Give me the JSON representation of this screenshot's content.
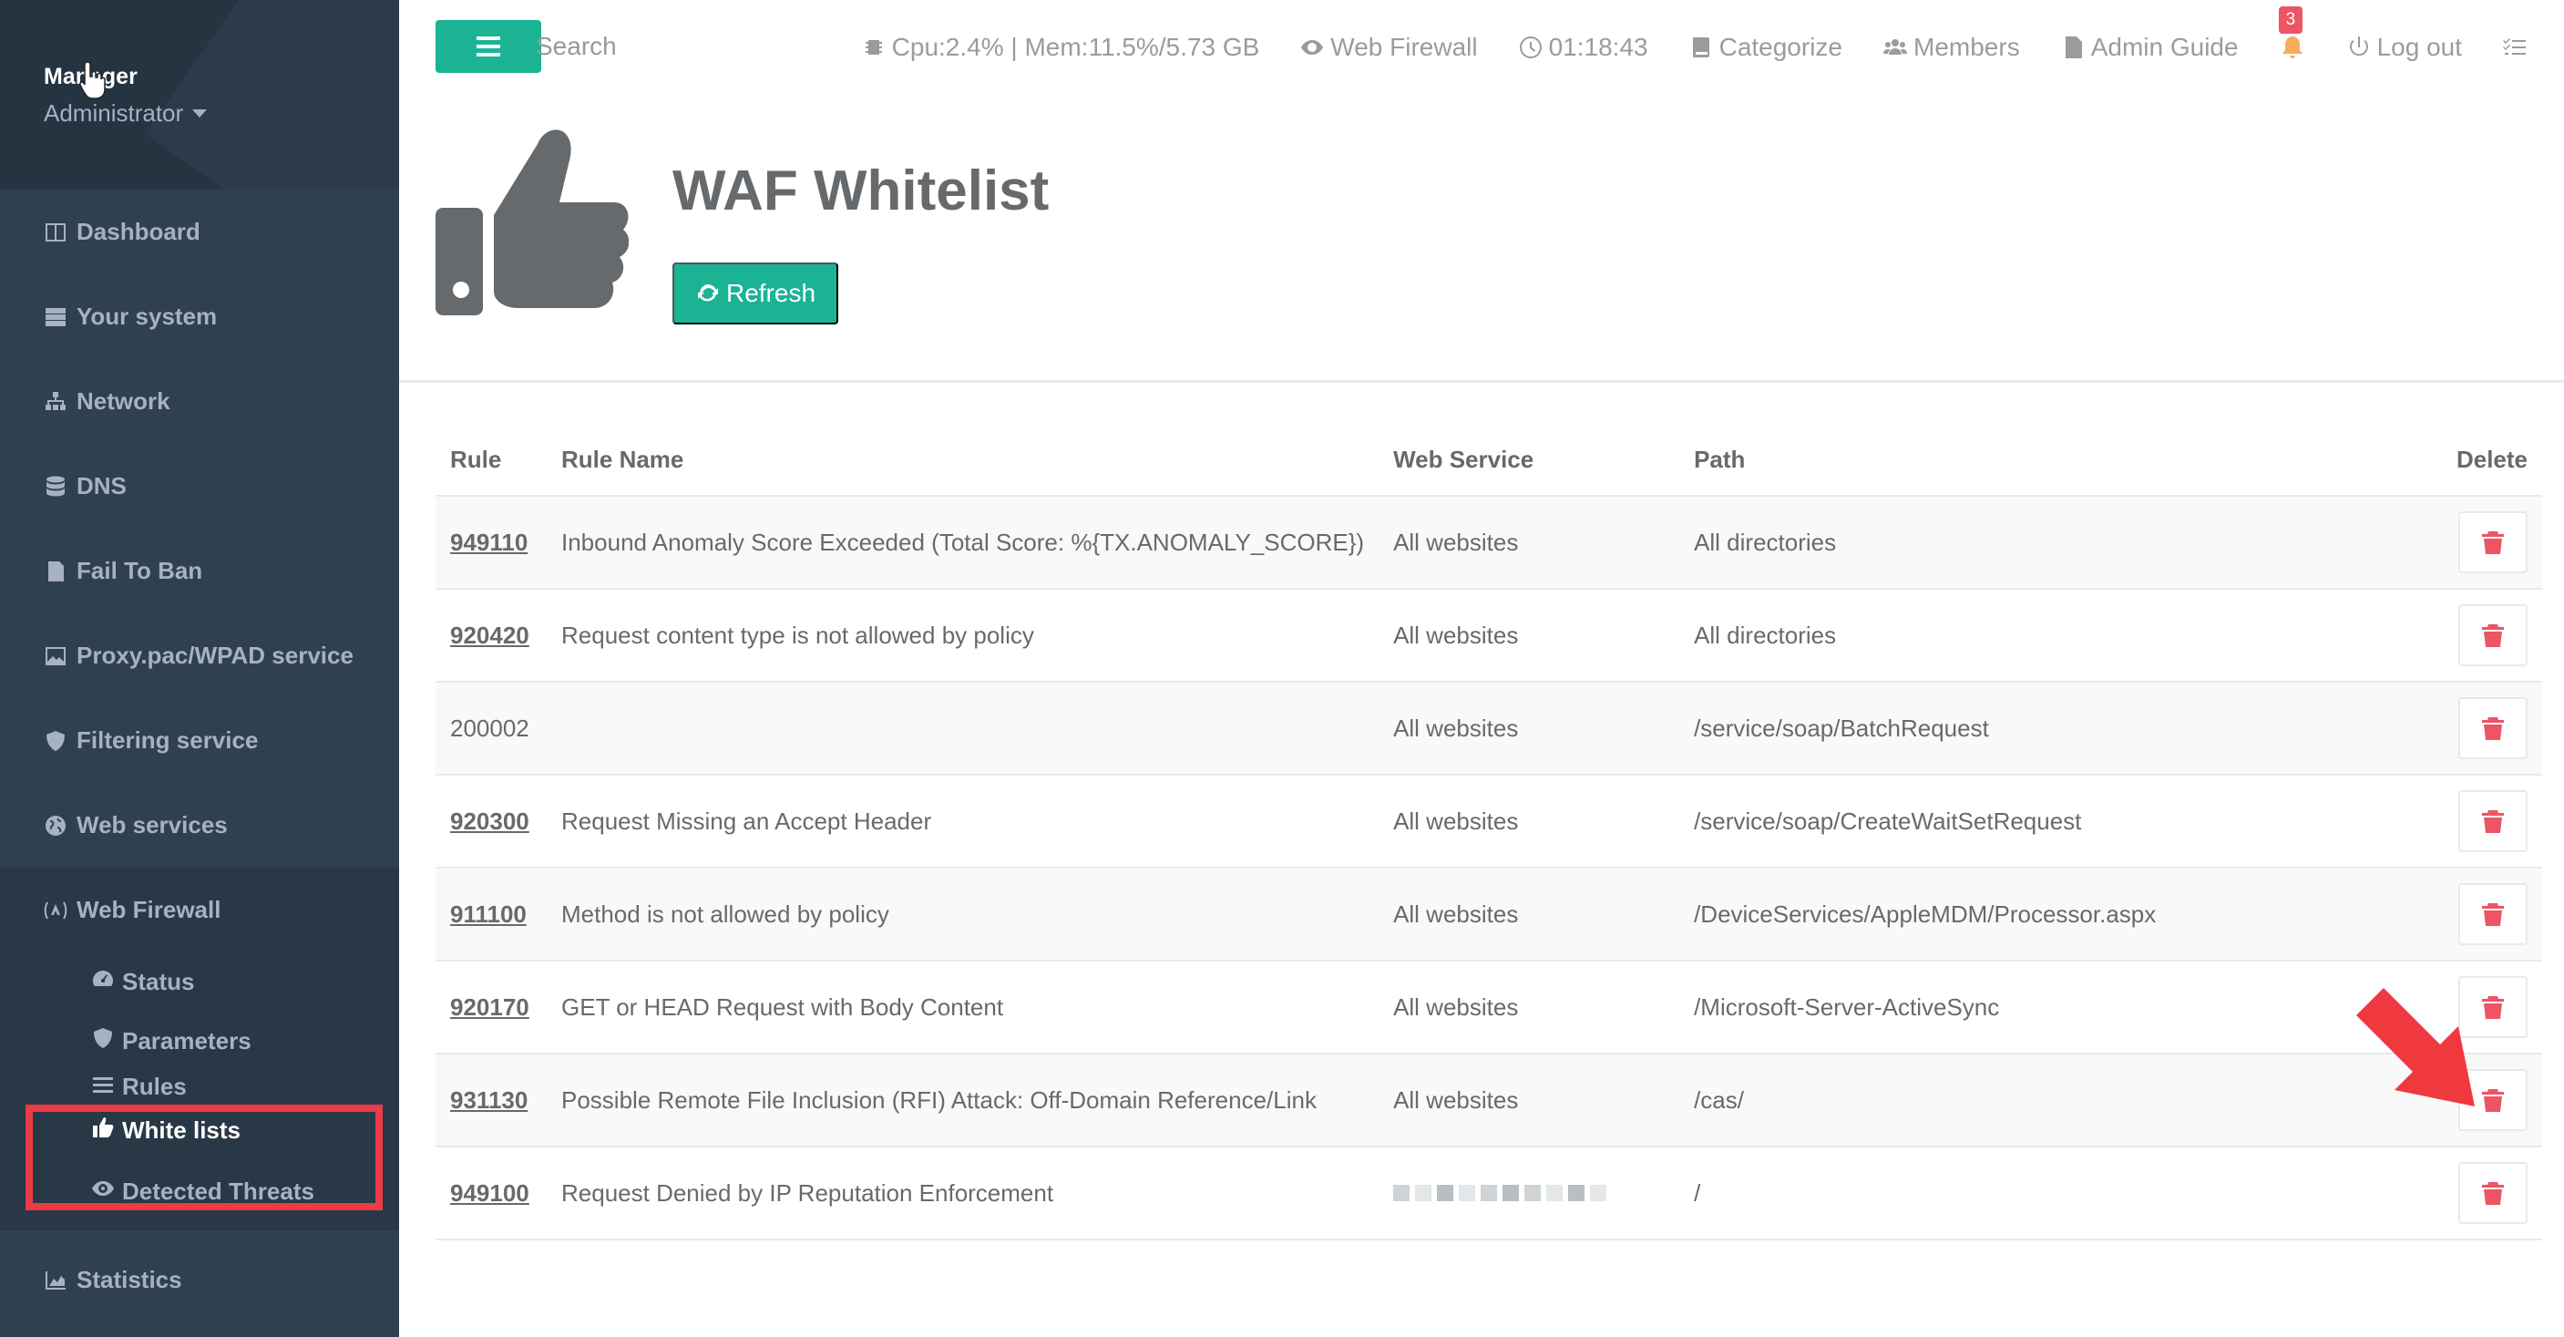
{
  "sidebar": {
    "profile_name": "Manager",
    "profile_role": "Administrator",
    "items": [
      {
        "label": "Dashboard",
        "icon": "columns-icon"
      },
      {
        "label": "Your system",
        "icon": "server-icon"
      },
      {
        "label": "Network",
        "icon": "sitemap-icon"
      },
      {
        "label": "DNS",
        "icon": "database-icon"
      },
      {
        "label": "Fail To Ban",
        "icon": "file-icon"
      },
      {
        "label": "Proxy.pac/WPAD service",
        "icon": "image-icon"
      },
      {
        "label": "Filtering service",
        "icon": "shield-icon"
      },
      {
        "label": "Web services",
        "icon": "globe-icon"
      },
      {
        "label": "Web Firewall",
        "icon": "waf-icon"
      }
    ],
    "subitems": {
      "status": "Status",
      "parameters": "Parameters",
      "rules": "Rules",
      "white_lists": "White lists",
      "detected_threats": "Detected Threats"
    },
    "statistics": "Statistics"
  },
  "topbar": {
    "search_placeholder": "Search",
    "cpu_mem": "Cpu:2.4% | Mem:11.5%/5.73 GB",
    "web_firewall": "Web Firewall",
    "time": "01:18:43",
    "categorize": "Categorize",
    "members": "Members",
    "admin_guide": "Admin Guide",
    "notifications_count": "3",
    "logout": "Log out"
  },
  "header": {
    "title": "WAF Whitelist",
    "refresh": "Refresh"
  },
  "table": {
    "columns": {
      "rule": "Rule",
      "name": "Rule Name",
      "service": "Web Service",
      "path": "Path",
      "delete": "Delete"
    },
    "rows": [
      {
        "rule": "949110",
        "name": "Inbound Anomaly Score Exceeded (Total Score: %{TX.ANOMALY_SCORE})",
        "service": "All websites",
        "path": "All directories"
      },
      {
        "rule": "920420",
        "name": "Request content type is not allowed by policy",
        "service": "All websites",
        "path": "All directories"
      },
      {
        "rule": "200002",
        "name": "",
        "service": "All websites",
        "path": "/service/soap/BatchRequest"
      },
      {
        "rule": "920300",
        "name": "Request Missing an Accept Header",
        "service": "All websites",
        "path": "/service/soap/CreateWaitSetRequest"
      },
      {
        "rule": "911100",
        "name": "Method is not allowed by policy",
        "service": "All websites",
        "path": "/DeviceServices/AppleMDM/Processor.aspx"
      },
      {
        "rule": "920170",
        "name": "GET or HEAD Request with Body Content",
        "service": "All websites",
        "path": "/Microsoft-Server-ActiveSync"
      },
      {
        "rule": "931130",
        "name": "Possible Remote File Inclusion (RFI) Attack: Off-Domain Reference/Link",
        "service": "All websites",
        "path": "/cas/"
      },
      {
        "rule": "949100",
        "name": "Request Denied by IP Reputation Enforcement",
        "service": "",
        "path": "/"
      }
    ]
  },
  "colors": {
    "accent": "#1ab394",
    "danger": "#ed5565",
    "sidebar": "#2f4050",
    "annotation": "#ea3b46"
  }
}
